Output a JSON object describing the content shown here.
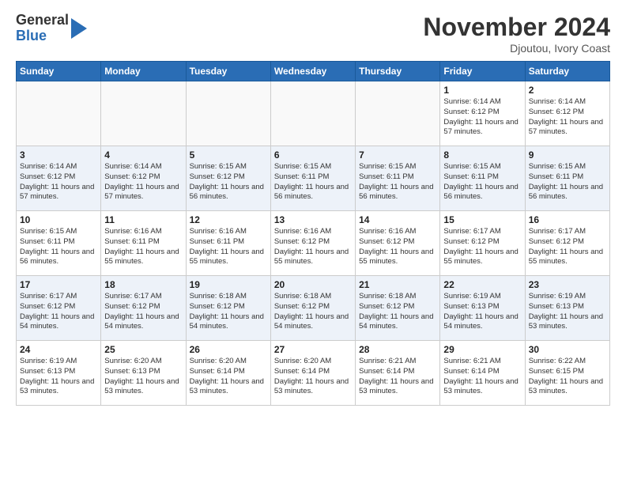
{
  "logo": {
    "general": "General",
    "blue": "Blue"
  },
  "title": "November 2024",
  "subtitle": "Djoutou, Ivory Coast",
  "days_header": [
    "Sunday",
    "Monday",
    "Tuesday",
    "Wednesday",
    "Thursday",
    "Friday",
    "Saturday"
  ],
  "weeks": [
    {
      "alt": false,
      "days": [
        {
          "num": "",
          "info": ""
        },
        {
          "num": "",
          "info": ""
        },
        {
          "num": "",
          "info": ""
        },
        {
          "num": "",
          "info": ""
        },
        {
          "num": "",
          "info": ""
        },
        {
          "num": "1",
          "info": "Sunrise: 6:14 AM\nSunset: 6:12 PM\nDaylight: 11 hours and 57 minutes."
        },
        {
          "num": "2",
          "info": "Sunrise: 6:14 AM\nSunset: 6:12 PM\nDaylight: 11 hours and 57 minutes."
        }
      ]
    },
    {
      "alt": true,
      "days": [
        {
          "num": "3",
          "info": "Sunrise: 6:14 AM\nSunset: 6:12 PM\nDaylight: 11 hours and 57 minutes."
        },
        {
          "num": "4",
          "info": "Sunrise: 6:14 AM\nSunset: 6:12 PM\nDaylight: 11 hours and 57 minutes."
        },
        {
          "num": "5",
          "info": "Sunrise: 6:15 AM\nSunset: 6:12 PM\nDaylight: 11 hours and 56 minutes."
        },
        {
          "num": "6",
          "info": "Sunrise: 6:15 AM\nSunset: 6:11 PM\nDaylight: 11 hours and 56 minutes."
        },
        {
          "num": "7",
          "info": "Sunrise: 6:15 AM\nSunset: 6:11 PM\nDaylight: 11 hours and 56 minutes."
        },
        {
          "num": "8",
          "info": "Sunrise: 6:15 AM\nSunset: 6:11 PM\nDaylight: 11 hours and 56 minutes."
        },
        {
          "num": "9",
          "info": "Sunrise: 6:15 AM\nSunset: 6:11 PM\nDaylight: 11 hours and 56 minutes."
        }
      ]
    },
    {
      "alt": false,
      "days": [
        {
          "num": "10",
          "info": "Sunrise: 6:15 AM\nSunset: 6:11 PM\nDaylight: 11 hours and 56 minutes."
        },
        {
          "num": "11",
          "info": "Sunrise: 6:16 AM\nSunset: 6:11 PM\nDaylight: 11 hours and 55 minutes."
        },
        {
          "num": "12",
          "info": "Sunrise: 6:16 AM\nSunset: 6:11 PM\nDaylight: 11 hours and 55 minutes."
        },
        {
          "num": "13",
          "info": "Sunrise: 6:16 AM\nSunset: 6:12 PM\nDaylight: 11 hours and 55 minutes."
        },
        {
          "num": "14",
          "info": "Sunrise: 6:16 AM\nSunset: 6:12 PM\nDaylight: 11 hours and 55 minutes."
        },
        {
          "num": "15",
          "info": "Sunrise: 6:17 AM\nSunset: 6:12 PM\nDaylight: 11 hours and 55 minutes."
        },
        {
          "num": "16",
          "info": "Sunrise: 6:17 AM\nSunset: 6:12 PM\nDaylight: 11 hours and 55 minutes."
        }
      ]
    },
    {
      "alt": true,
      "days": [
        {
          "num": "17",
          "info": "Sunrise: 6:17 AM\nSunset: 6:12 PM\nDaylight: 11 hours and 54 minutes."
        },
        {
          "num": "18",
          "info": "Sunrise: 6:17 AM\nSunset: 6:12 PM\nDaylight: 11 hours and 54 minutes."
        },
        {
          "num": "19",
          "info": "Sunrise: 6:18 AM\nSunset: 6:12 PM\nDaylight: 11 hours and 54 minutes."
        },
        {
          "num": "20",
          "info": "Sunrise: 6:18 AM\nSunset: 6:12 PM\nDaylight: 11 hours and 54 minutes."
        },
        {
          "num": "21",
          "info": "Sunrise: 6:18 AM\nSunset: 6:12 PM\nDaylight: 11 hours and 54 minutes."
        },
        {
          "num": "22",
          "info": "Sunrise: 6:19 AM\nSunset: 6:13 PM\nDaylight: 11 hours and 54 minutes."
        },
        {
          "num": "23",
          "info": "Sunrise: 6:19 AM\nSunset: 6:13 PM\nDaylight: 11 hours and 53 minutes."
        }
      ]
    },
    {
      "alt": false,
      "days": [
        {
          "num": "24",
          "info": "Sunrise: 6:19 AM\nSunset: 6:13 PM\nDaylight: 11 hours and 53 minutes."
        },
        {
          "num": "25",
          "info": "Sunrise: 6:20 AM\nSunset: 6:13 PM\nDaylight: 11 hours and 53 minutes."
        },
        {
          "num": "26",
          "info": "Sunrise: 6:20 AM\nSunset: 6:14 PM\nDaylight: 11 hours and 53 minutes."
        },
        {
          "num": "27",
          "info": "Sunrise: 6:20 AM\nSunset: 6:14 PM\nDaylight: 11 hours and 53 minutes."
        },
        {
          "num": "28",
          "info": "Sunrise: 6:21 AM\nSunset: 6:14 PM\nDaylight: 11 hours and 53 minutes."
        },
        {
          "num": "29",
          "info": "Sunrise: 6:21 AM\nSunset: 6:14 PM\nDaylight: 11 hours and 53 minutes."
        },
        {
          "num": "30",
          "info": "Sunrise: 6:22 AM\nSunset: 6:15 PM\nDaylight: 11 hours and 53 minutes."
        }
      ]
    }
  ]
}
